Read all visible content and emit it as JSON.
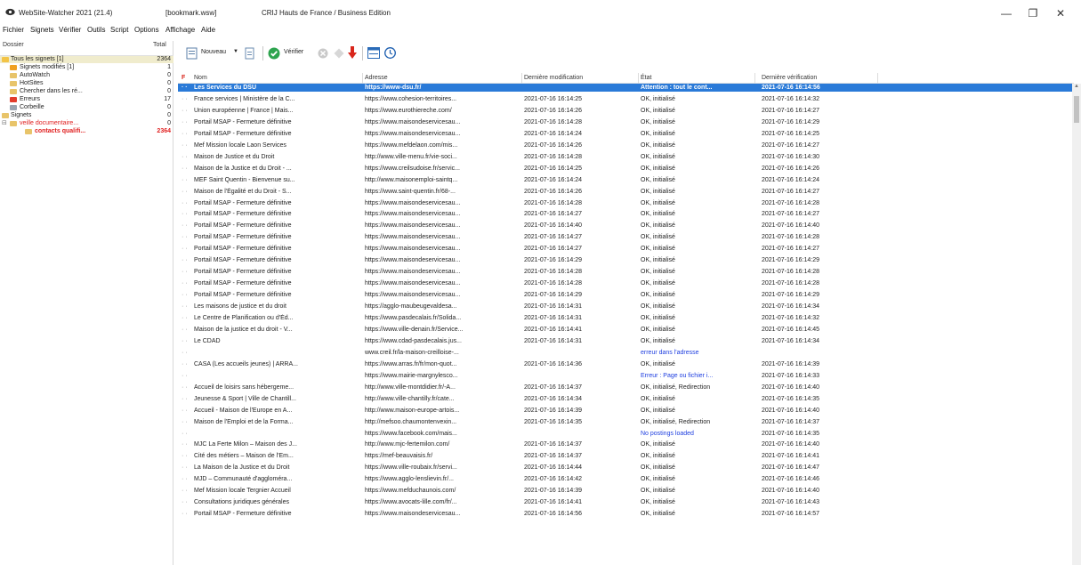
{
  "window": {
    "app_title": "WebSite-Watcher 2021 (21.4)",
    "file": "[bookmark.wsw]",
    "license": "CRIJ Hauts de France / Business Edition",
    "minimize": "—",
    "maximize": "❐",
    "close": "✕"
  },
  "menu": [
    "Fichier",
    "Signets",
    "Vérifier",
    "Outils",
    "Script",
    "Options",
    "Affichage",
    "Aide"
  ],
  "left_pane": {
    "header_folder": "Dossier",
    "header_total": "Total",
    "items": [
      {
        "label": "Tous les signets [1]",
        "count": "2364"
      },
      {
        "label": "Signets modifiés [1]",
        "count": "1"
      },
      {
        "label": "AutoWatch",
        "count": "0"
      },
      {
        "label": "HotSites",
        "count": "0"
      },
      {
        "label": "Chercher dans les ré...",
        "count": "0"
      },
      {
        "label": "Erreurs",
        "count": "17"
      },
      {
        "label": "Corbeille",
        "count": "0"
      },
      {
        "label": "Signets",
        "count": "0"
      },
      {
        "label": "veille documentaire...",
        "count": "0"
      },
      {
        "label": "contacts qualifi...",
        "count": "2364"
      }
    ]
  },
  "toolbar": {
    "new_label": "Nouveau",
    "check_label": "Vérifier"
  },
  "table": {
    "headers": {
      "flag": "F",
      "name": "Nom",
      "address": "Adresse",
      "modified": "Dernière modification",
      "state": "État",
      "checked": "Dernière vérification"
    },
    "rows": [
      {
        "name": "Les Services du DSU",
        "address": "https://www-dsu.fr/",
        "modified": "",
        "state": "Attention : tout le cont...",
        "checked": "2021-07-16 16:14:56"
      },
      {
        "name": "France services | Ministère de la C...",
        "address": "https://www.cohesion-territoires...",
        "modified": "2021-07-16 16:14:25",
        "state": "OK, initialisé",
        "checked": "2021-07-16 16:14:32"
      },
      {
        "name": "Union européenne | France | Mais...",
        "address": "https://www.eurothiereche.com/",
        "modified": "2021-07-16 16:14:26",
        "state": "OK, initialisé",
        "checked": "2021-07-16 16:14:27"
      },
      {
        "name": "Portail MSAP - Fermeture définitive",
        "address": "https://www.maisondeservicesau...",
        "modified": "2021-07-16 16:14:28",
        "state": "OK, initialisé",
        "checked": "2021-07-16 16:14:29"
      },
      {
        "name": "Portail MSAP - Fermeture définitive",
        "address": "https://www.maisondeservicesau...",
        "modified": "2021-07-16 16:14:24",
        "state": "OK, initialisé",
        "checked": "2021-07-16 16:14:25"
      },
      {
        "name": "Mef Mission locale Laon Services",
        "address": "https://www.mefdelaon.com/mis...",
        "modified": "2021-07-16 16:14:26",
        "state": "OK, initialisé",
        "checked": "2021-07-16 16:14:27"
      },
      {
        "name": "Maison de Justice et du Droit",
        "address": "http://www.ville-menu.fr/vie-soci...",
        "modified": "2021-07-16 16:14:28",
        "state": "OK, initialisé",
        "checked": "2021-07-16 16:14:30"
      },
      {
        "name": "Maison de la Justice et du Droit - ...",
        "address": "https://www.creilsudoise.fr/servic...",
        "modified": "2021-07-16 16:14:25",
        "state": "OK, initialisé",
        "checked": "2021-07-16 16:14:26"
      },
      {
        "name": "MEF Saint Quentin - Bienvenue su...",
        "address": "http://www.maisonemploi-saintq...",
        "modified": "2021-07-16 16:14:24",
        "state": "OK, initialisé",
        "checked": "2021-07-16 16:14:24"
      },
      {
        "name": "Maison de l'Égalité et du Droit - S...",
        "address": "https://www.saint-quentin.fr/68-...",
        "modified": "2021-07-16 16:14:26",
        "state": "OK, initialisé",
        "checked": "2021-07-16 16:14:27"
      },
      {
        "name": "Portail MSAP - Fermeture définitive",
        "address": "https://www.maisondeservicesau...",
        "modified": "2021-07-16 16:14:28",
        "state": "OK, initialisé",
        "checked": "2021-07-16 16:14:28"
      },
      {
        "name": "Portail MSAP - Fermeture définitive",
        "address": "https://www.maisondeservicesau...",
        "modified": "2021-07-16 16:14:27",
        "state": "OK, initialisé",
        "checked": "2021-07-16 16:14:27"
      },
      {
        "name": "Portail MSAP - Fermeture définitive",
        "address": "https://www.maisondeservicesau...",
        "modified": "2021-07-16 16:14:40",
        "state": "OK, initialisé",
        "checked": "2021-07-16 16:14:40"
      },
      {
        "name": "Portail MSAP - Fermeture définitive",
        "address": "https://www.maisondeservicesau...",
        "modified": "2021-07-16 16:14:27",
        "state": "OK, initialisé",
        "checked": "2021-07-16 16:14:28"
      },
      {
        "name": "Portail MSAP - Fermeture définitive",
        "address": "https://www.maisondeservicesau...",
        "modified": "2021-07-16 16:14:27",
        "state": "OK, initialisé",
        "checked": "2021-07-16 16:14:27"
      },
      {
        "name": "Portail MSAP - Fermeture définitive",
        "address": "https://www.maisondeservicesau...",
        "modified": "2021-07-16 16:14:29",
        "state": "OK, initialisé",
        "checked": "2021-07-16 16:14:29"
      },
      {
        "name": "Portail MSAP - Fermeture définitive",
        "address": "https://www.maisondeservicesau...",
        "modified": "2021-07-16 16:14:28",
        "state": "OK, initialisé",
        "checked": "2021-07-16 16:14:28"
      },
      {
        "name": "Portail MSAP - Fermeture définitive",
        "address": "https://www.maisondeservicesau...",
        "modified": "2021-07-16 16:14:28",
        "state": "OK, initialisé",
        "checked": "2021-07-16 16:14:28"
      },
      {
        "name": "Portail MSAP - Fermeture définitive",
        "address": "https://www.maisondeservicesau...",
        "modified": "2021-07-16 16:14:29",
        "state": "OK, initialisé",
        "checked": "2021-07-16 16:14:29"
      },
      {
        "name": "Les maisons de justice et du droit",
        "address": "https://agglo-maubeugevaldesa...",
        "modified": "2021-07-16 16:14:31",
        "state": "OK, initialisé",
        "checked": "2021-07-16 16:14:34"
      },
      {
        "name": "Le Centre de Planification ou d'Éd...",
        "address": "https://www.pasdecalais.fr/Solida...",
        "modified": "2021-07-16 16:14:31",
        "state": "OK, initialisé",
        "checked": "2021-07-16 16:14:32"
      },
      {
        "name": "Maison de la justice et du droit - V...",
        "address": "https://www.ville-denain.fr/Service...",
        "modified": "2021-07-16 16:14:41",
        "state": "OK, initialisé",
        "checked": "2021-07-16 16:14:45"
      },
      {
        "name": "Le CDAD",
        "address": "https://www.cdad-pasdecalais.jus...",
        "modified": "2021-07-16 16:14:31",
        "state": "OK, initialisé",
        "checked": "2021-07-16 16:14:34"
      },
      {
        "name": "",
        "address": "www.creil.fr/la-maison-creilloise-...",
        "modified": "",
        "state": "erreur dans l'adresse",
        "checked": "",
        "error": true
      },
      {
        "name": "CASA (Les accueils jeunes) | ARRA...",
        "address": "https://www.arras.fr/fr/mon-quot...",
        "modified": "2021-07-16 16:14:36",
        "state": "OK, initialisé",
        "checked": "2021-07-16 16:14:39"
      },
      {
        "name": "",
        "address": "https://www.mairie-margnylesco...",
        "modified": "",
        "state": "Erreur : Page ou fichier i...",
        "checked": "2021-07-16 16:14:33",
        "error": true
      },
      {
        "name": "Accueil de loisirs sans hébergeme...",
        "address": "http://www.ville-montdidier.fr/-A...",
        "modified": "2021-07-16 16:14:37",
        "state": "OK, initialisé, Redirection",
        "checked": "2021-07-16 16:14:40"
      },
      {
        "name": "Jeunesse & Sport | Ville de Chantill...",
        "address": "http://www.ville-chantilly.fr/cate...",
        "modified": "2021-07-16 16:14:34",
        "state": "OK, initialisé",
        "checked": "2021-07-16 16:14:35"
      },
      {
        "name": "Accueil - Maison de l'Europe en A...",
        "address": "http://www.maison-europe-artois...",
        "modified": "2021-07-16 16:14:39",
        "state": "OK, initialisé",
        "checked": "2021-07-16 16:14:40"
      },
      {
        "name": "Maison de l'Emploi et de la Forma...",
        "address": "http://mefsoo.chaumontenvexin...",
        "modified": "2021-07-16 16:14:35",
        "state": "OK, initialisé, Redirection",
        "checked": "2021-07-16 16:14:37"
      },
      {
        "name": "",
        "address": "https://www.facebook.com/mais...",
        "modified": "",
        "state": "No postings loaded",
        "checked": "2021-07-16 16:14:35",
        "error": true
      },
      {
        "name": "MJC La Ferte Milon – Maison des J...",
        "address": "http://www.mjc-fertemilon.com/",
        "modified": "2021-07-16 16:14:37",
        "state": "OK, initialisé",
        "checked": "2021-07-16 16:14:40"
      },
      {
        "name": "Cité des métiers – Maison de l'Em...",
        "address": "https://mef-beauvaisis.fr/",
        "modified": "2021-07-16 16:14:37",
        "state": "OK, initialisé",
        "checked": "2021-07-16 16:14:41"
      },
      {
        "name": "La Maison de la Justice et du Droit",
        "address": "https://www.ville-roubaix.fr/servi...",
        "modified": "2021-07-16 16:14:44",
        "state": "OK, initialisé",
        "checked": "2021-07-16 16:14:47"
      },
      {
        "name": "MJD – Communauté d'aggloméra...",
        "address": "https://www.agglo-lenslievin.fr/...",
        "modified": "2021-07-16 16:14:42",
        "state": "OK, initialisé",
        "checked": "2021-07-16 16:14:46"
      },
      {
        "name": "Mef Mission locale Tergnier Accueil",
        "address": "https://www.mefduchaunois.com/",
        "modified": "2021-07-16 16:14:39",
        "state": "OK, initialisé",
        "checked": "2021-07-16 16:14:40"
      },
      {
        "name": "Consultations juridiques générales",
        "address": "https://www.avocats-lille.com/fr/...",
        "modified": "2021-07-16 16:14:41",
        "state": "OK, initialisé",
        "checked": "2021-07-16 16:14:43"
      },
      {
        "name": "Portail MSAP - Fermeture définitive",
        "address": "https://www.maisondeservicesau...",
        "modified": "2021-07-16 16:14:56",
        "state": "OK, initialisé",
        "checked": "2021-07-16 16:14:57"
      }
    ]
  },
  "colors": {
    "selection": "#2a7ad8",
    "error_text": "#2040e0",
    "red_text": "#e02020",
    "folder": "#f3c447",
    "check_green": "#2ea44f",
    "arrow_red": "#d9261c"
  }
}
